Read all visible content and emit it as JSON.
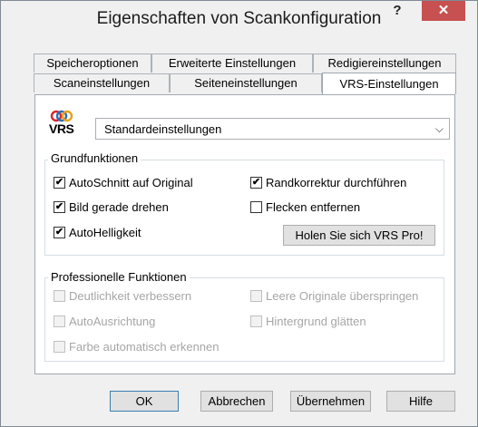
{
  "window": {
    "title": "Eigenschaften von Scankonfiguration",
    "help_label": "?",
    "close_label": "✕"
  },
  "tabs_row1": [
    {
      "label": "Speicheroptionen"
    },
    {
      "label": "Erweiterte Einstellungen"
    },
    {
      "label": "Redigiereinstellungen"
    }
  ],
  "tabs_row2": [
    {
      "label": "Scaneinstellungen"
    },
    {
      "label": "Seiteneinstellungen"
    },
    {
      "label": "VRS-Einstellungen",
      "active": true
    }
  ],
  "vrs": {
    "logo_text": "VRS",
    "preset_value": "Standardeinstellungen"
  },
  "basic": {
    "title": "Grundfunktionen",
    "items": [
      {
        "label": "AutoSchnitt auf Original",
        "checked": true
      },
      {
        "label": "Bild gerade drehen",
        "checked": true
      },
      {
        "label": "AutoHelligkeit",
        "checked": true
      },
      {
        "label": "Randkorrektur durchführen",
        "checked": true
      },
      {
        "label": "Flecken entfernen",
        "checked": false
      }
    ],
    "get_pro_label": "Holen Sie sich VRS Pro!"
  },
  "pro": {
    "title": "Professionelle Funktionen",
    "items": [
      {
        "label": "Deutlichkeit verbessern",
        "checked": false
      },
      {
        "label": "AutoAusrichtung",
        "checked": false
      },
      {
        "label": "Farbe automatisch erkennen",
        "checked": false
      },
      {
        "label": "Leere Originale überspringen",
        "checked": false
      },
      {
        "label": "Hintergrund glätten",
        "checked": false
      }
    ]
  },
  "footer": {
    "ok_label": "OK",
    "cancel_label": "Abbrechen",
    "apply_label": "Übernehmen",
    "help_label": "Hilfe"
  },
  "colors": {
    "close_button": "#c75050",
    "logo_red": "#d9262c",
    "logo_blue": "#2c6fb7"
  }
}
